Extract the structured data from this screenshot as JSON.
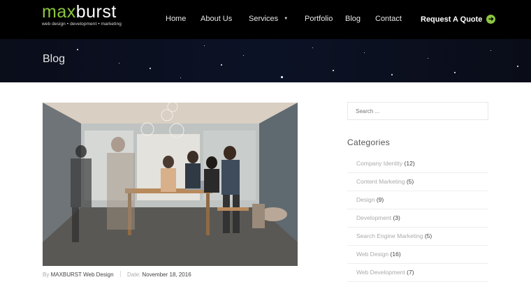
{
  "brand": {
    "logo_prefix": "max",
    "logo_suffix": "burst",
    "tagline": "web design • development • marketing"
  },
  "nav": {
    "items": [
      {
        "label": "Home"
      },
      {
        "label": "About Us"
      },
      {
        "label": "Services",
        "caret": "▼"
      },
      {
        "label": "Portfolio"
      },
      {
        "label": "Blog"
      },
      {
        "label": "Contact"
      }
    ],
    "cta": "Request A Quote"
  },
  "hero": {
    "title": "Blog"
  },
  "post": {
    "by_label": "By",
    "author": "MAXBURST Web Design",
    "date_label": "Date:",
    "date": "November 18, 2016"
  },
  "sidebar": {
    "search_placeholder": "Search ...",
    "categories_title": "Categories",
    "categories": [
      {
        "name": "Company Identity",
        "count": "(12)"
      },
      {
        "name": "Content Marketing",
        "count": "(5)"
      },
      {
        "name": "Design",
        "count": "(9)"
      },
      {
        "name": "Development",
        "count": "(3)"
      },
      {
        "name": "Search Engine Marketing",
        "count": "(5)"
      },
      {
        "name": "Web Design",
        "count": "(16)"
      },
      {
        "name": "Web Development",
        "count": "(7)"
      }
    ]
  },
  "colors": {
    "accent": "#8cc63f",
    "header_bg": "#000000",
    "hero_bg": "#0c1226"
  }
}
